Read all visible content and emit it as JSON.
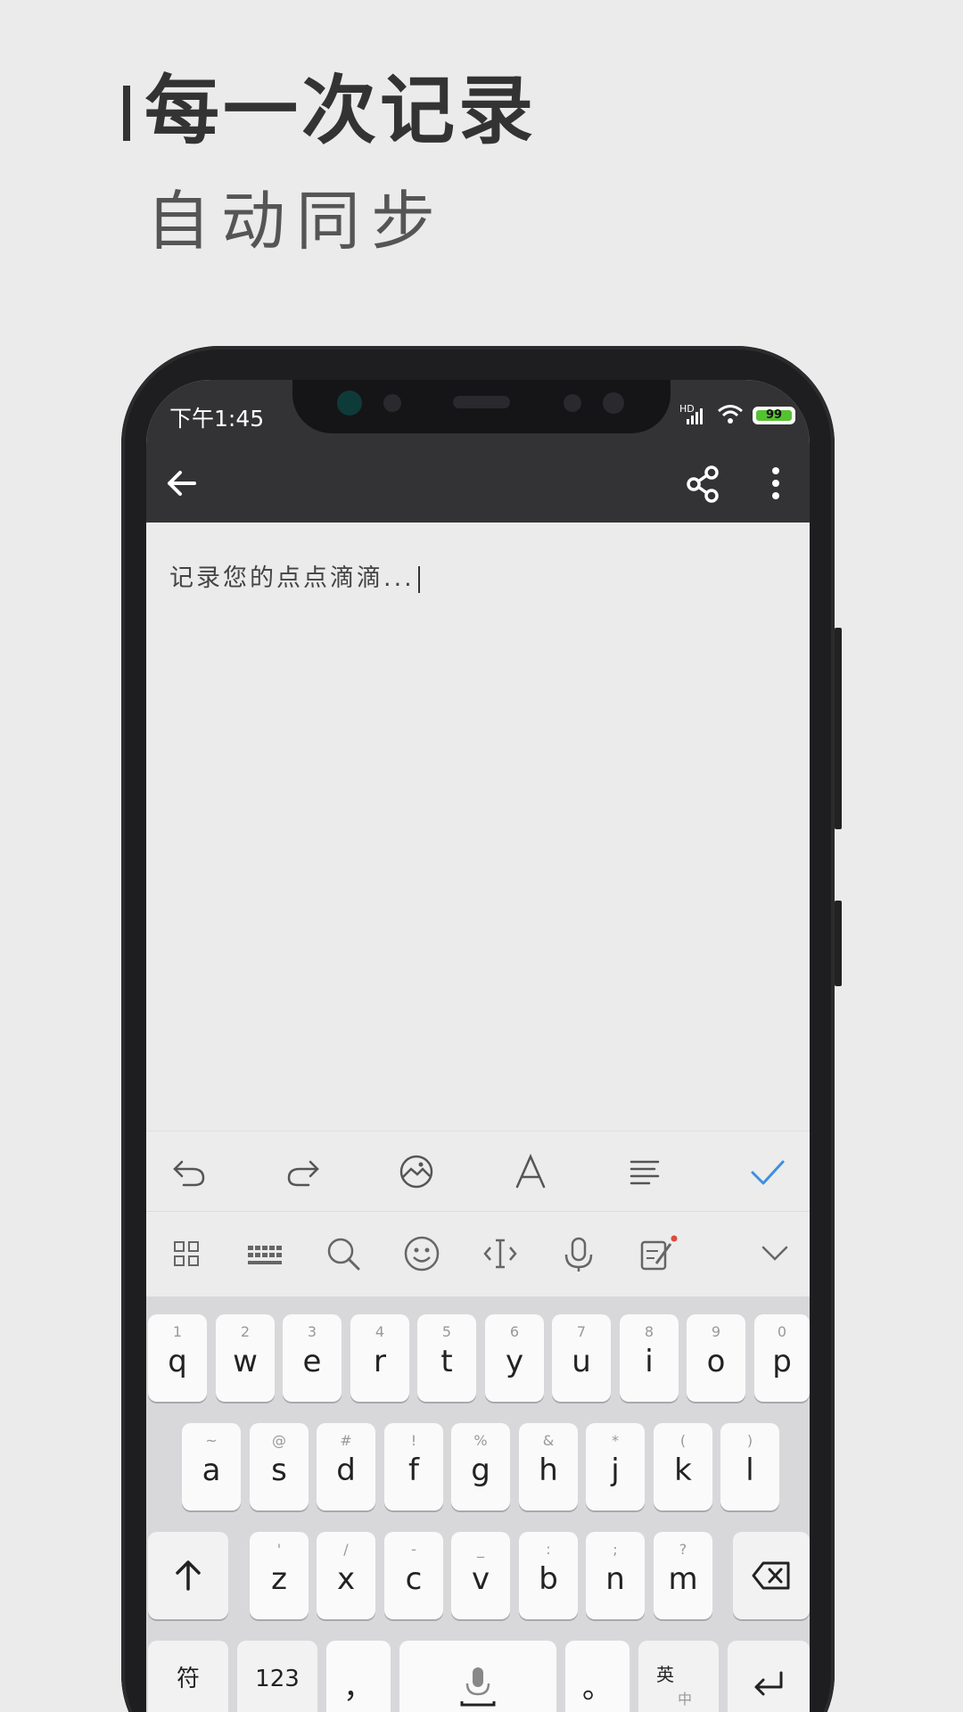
{
  "promo": {
    "title": "每一次记录",
    "subtitle": "自动同步"
  },
  "status_bar": {
    "time": "下午1:45",
    "network_badge": "HD",
    "battery_level": "99",
    "battery_color": "#55c232"
  },
  "toolbar": {
    "icons": [
      "back-arrow-icon",
      "share-icon",
      "more-vertical-icon"
    ]
  },
  "editor": {
    "placeholder": "记录您的点点滴滴..."
  },
  "format_bar": {
    "icons": [
      "undo-icon",
      "redo-icon",
      "image-icon",
      "font-icon",
      "align-icon",
      "check-icon"
    ],
    "accent_color": "#3d8fe0"
  },
  "ime_bar": {
    "icons": [
      "grid-icon",
      "keyboard-icon",
      "search-icon",
      "emoji-icon",
      "cursor-icon",
      "microphone-icon",
      "handwriting-icon",
      "collapse-chevron-icon"
    ]
  },
  "keyboard": {
    "row1": [
      {
        "key": "q",
        "hint": "1"
      },
      {
        "key": "w",
        "hint": "2"
      },
      {
        "key": "e",
        "hint": "3"
      },
      {
        "key": "r",
        "hint": "4"
      },
      {
        "key": "t",
        "hint": "5"
      },
      {
        "key": "y",
        "hint": "6"
      },
      {
        "key": "u",
        "hint": "7"
      },
      {
        "key": "i",
        "hint": "8"
      },
      {
        "key": "o",
        "hint": "9"
      },
      {
        "key": "p",
        "hint": "0"
      }
    ],
    "row2": [
      {
        "key": "a",
        "hint": "~"
      },
      {
        "key": "s",
        "hint": "@"
      },
      {
        "key": "d",
        "hint": "#"
      },
      {
        "key": "f",
        "hint": "!"
      },
      {
        "key": "g",
        "hint": "%"
      },
      {
        "key": "h",
        "hint": "&"
      },
      {
        "key": "j",
        "hint": "*"
      },
      {
        "key": "k",
        "hint": "("
      },
      {
        "key": "l",
        "hint": ")"
      }
    ],
    "row3": [
      {
        "key": "z",
        "hint": "'"
      },
      {
        "key": "x",
        "hint": "/"
      },
      {
        "key": "c",
        "hint": "-"
      },
      {
        "key": "v",
        "hint": "_"
      },
      {
        "key": "b",
        "hint": ":"
      },
      {
        "key": "n",
        "hint": ";"
      },
      {
        "key": "m",
        "hint": "?"
      }
    ],
    "symbols_label": "符",
    "numbers_label": "123",
    "comma_label": "，",
    "period_label": "。",
    "lang_top": "英",
    "lang_bottom": "中"
  }
}
